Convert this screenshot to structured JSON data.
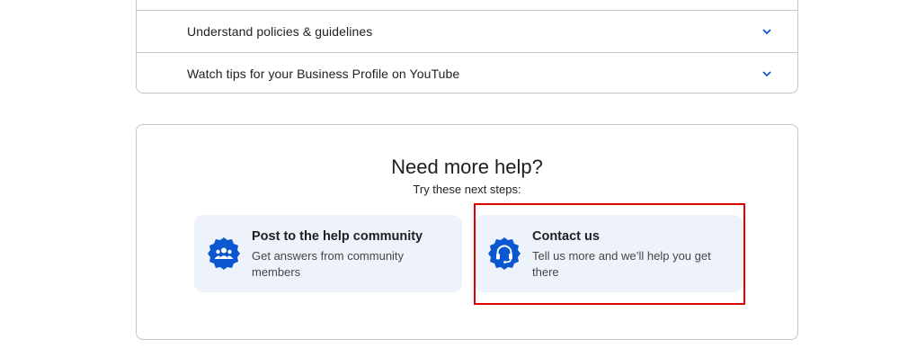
{
  "accordion": {
    "items": [
      {
        "label": "Understand policies & guidelines"
      },
      {
        "label": "Watch tips for your Business Profile on YouTube"
      }
    ]
  },
  "help": {
    "title": "Need more help?",
    "subtitle": "Try these next steps:",
    "cards": [
      {
        "title": "Post to the help community",
        "description": "Get answers from community members",
        "icon": "community-icon"
      },
      {
        "title": "Contact us",
        "description": "Tell us more and we’ll help you get there",
        "icon": "headset-icon"
      }
    ]
  },
  "colors": {
    "accent": "#0b57d0",
    "card_bg": "#eef3fb",
    "highlight": "#e00000"
  }
}
